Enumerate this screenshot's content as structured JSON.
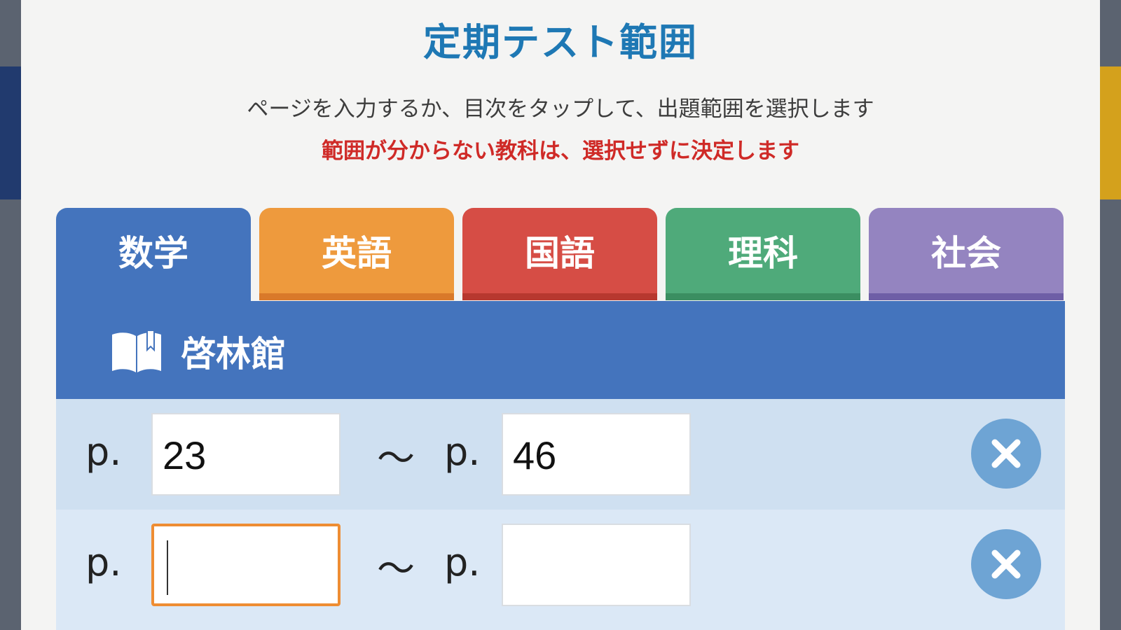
{
  "title": "定期テスト範囲",
  "instruction": "ページを入力するか、目次をタップして、出題範囲を選択します",
  "warning": "範囲が分からない教科は、選択せずに決定します",
  "tabs": [
    {
      "label": "数学",
      "color": "#4474bd",
      "selected": true
    },
    {
      "label": "英語",
      "color": "#ee9a3d",
      "selected": false
    },
    {
      "label": "国語",
      "color": "#d64d45",
      "selected": false
    },
    {
      "label": "理科",
      "color": "#4faa7a",
      "selected": false
    },
    {
      "label": "社会",
      "color": "#9484c0",
      "selected": false
    }
  ],
  "publisher": {
    "icon": "book-icon",
    "name": "啓林館"
  },
  "ranges": [
    {
      "prefix": "p.",
      "separator": "〜",
      "from": "23",
      "to": "46",
      "delete_icon": "close-icon"
    },
    {
      "prefix": "p.",
      "separator": "〜",
      "from": "",
      "to": "",
      "focused": true,
      "delete_icon": "close-icon"
    }
  ]
}
